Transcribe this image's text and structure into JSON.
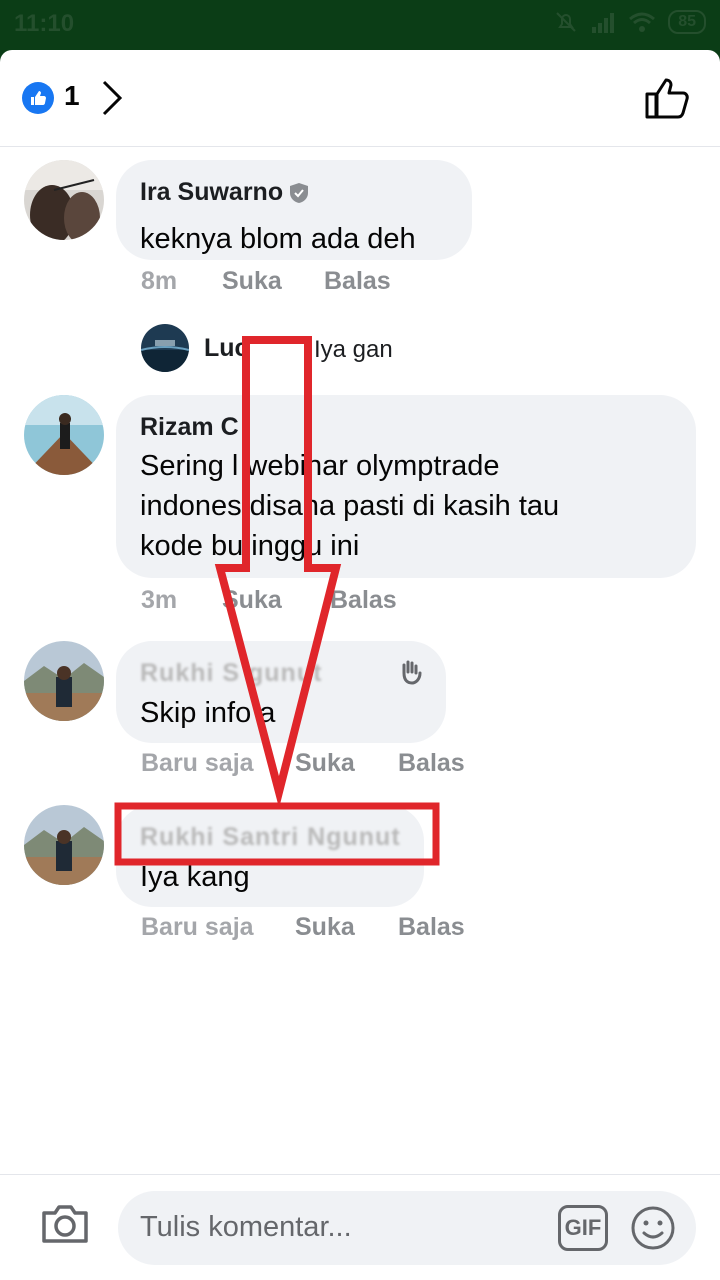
{
  "status": {
    "time": "11:10",
    "battery": "85"
  },
  "header": {
    "reaction_count": "1"
  },
  "comments": [
    {
      "name": "Ira Suwarno",
      "text": "keknya blom ada deh",
      "time": "8m",
      "like": "Suka",
      "reply": "Balas"
    },
    {
      "name": "Rizam C",
      "text_lines": [
        "Sering l  webinar olymptrade",
        "indones  disana pasti di kasih tau",
        "kode bu   inggu ini"
      ],
      "time": "3m",
      "like": "Suka",
      "reply": "Balas"
    },
    {
      "name": "Rukhi S        gunut",
      "text": "Skip info   a",
      "time": "Baru saja",
      "like": "Suka",
      "reply": "Balas"
    },
    {
      "name": "Rukhi Santri Ngunut",
      "text": "Iya kang",
      "time": "Baru saja",
      "like": "Suka",
      "reply": "Balas"
    }
  ],
  "reply_preview": {
    "name": "Luc",
    "text": "Iya gan"
  },
  "composer": {
    "placeholder": "Tulis komentar...",
    "gif": "GIF"
  },
  "colors": {
    "brand": "#1877f2",
    "status_bar": "#0b3d16",
    "annotation": "#e0262b"
  }
}
